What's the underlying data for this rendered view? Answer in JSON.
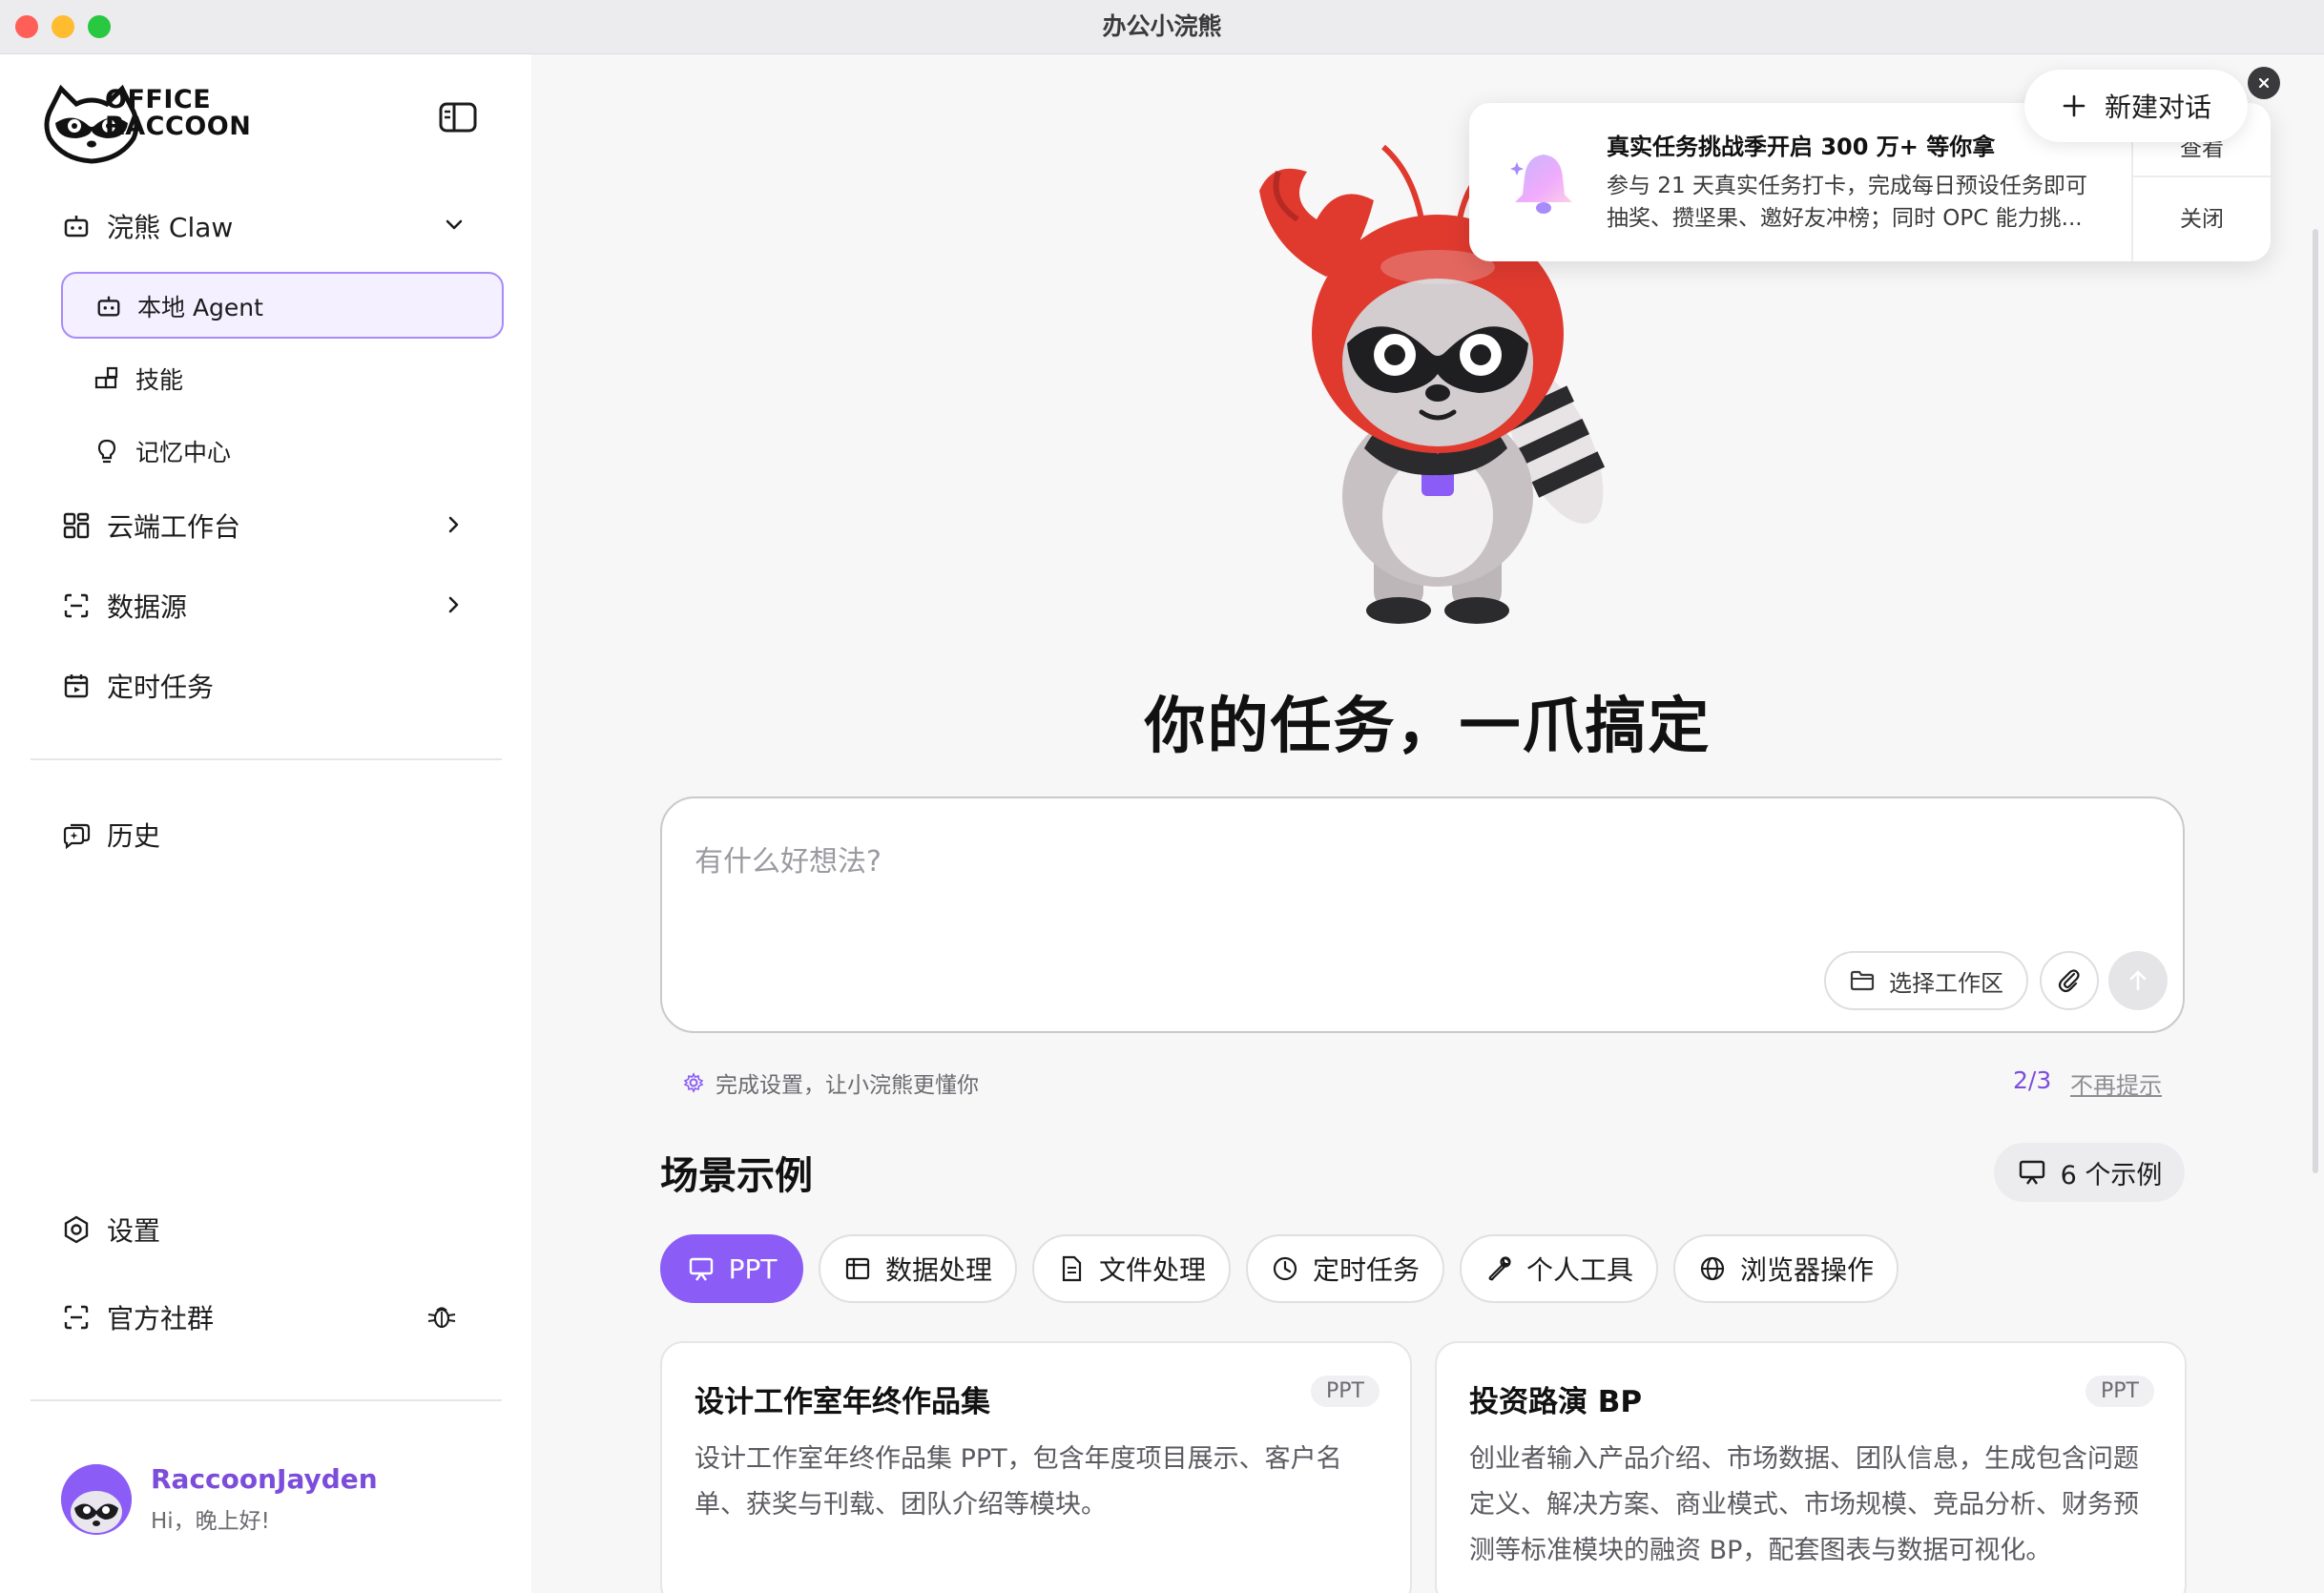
{
  "window": {
    "title": "办公小浣熊"
  },
  "sidebar": {
    "logo_text_1": "OFFICE",
    "logo_text_2": "RACCOON",
    "claw": {
      "label": "浣熊 Claw"
    },
    "claw_items": [
      {
        "label": "本地 Agent",
        "icon": "robot-icon",
        "selected": true
      },
      {
        "label": "技能",
        "icon": "skills-icon"
      },
      {
        "label": "记忆中心",
        "icon": "bulb-icon"
      }
    ],
    "cloud": {
      "label": "云端工作台"
    },
    "datasource": {
      "label": "数据源"
    },
    "scheduled": {
      "label": "定时任务"
    },
    "history": {
      "label": "历史"
    },
    "settings": {
      "label": "设置"
    },
    "community": {
      "label": "官方社群"
    },
    "user": {
      "name": "RaccoonJayden",
      "greeting": "Hi，晚上好!"
    }
  },
  "header": {
    "new_chat_label": "新建对话"
  },
  "notification": {
    "title": "真实任务挑战季开启 300 万+ 等你拿",
    "body": "参与 21 天真实任务打卡，完成每日预设任务即可抽奖、攒坚果、邀好友冲榜；同时 OPC 能力挑...",
    "view_label": "查看",
    "close_label": "关闭"
  },
  "main": {
    "headline": "你的任务，一爪搞定",
    "prompt": {
      "placeholder": "有什么好想法?",
      "value": "",
      "workspace_label": "选择工作区"
    },
    "setup": {
      "hint": "完成设置，让小浣熊更懂你",
      "progress": "2/3",
      "dismiss": "不再提示"
    },
    "scenes_title": "场景示例",
    "examples_label": "6 个示例",
    "categories": [
      {
        "label": "PPT",
        "icon": "presentation-icon",
        "active": true
      },
      {
        "label": "数据处理",
        "icon": "table-icon"
      },
      {
        "label": "文件处理",
        "icon": "document-icon"
      },
      {
        "label": "定时任务",
        "icon": "clock-icon"
      },
      {
        "label": "个人工具",
        "icon": "wrench-icon"
      },
      {
        "label": "浏览器操作",
        "icon": "globe-icon"
      }
    ],
    "cards": [
      {
        "title": "设计工作室年终作品集",
        "tag": "PPT",
        "desc": "设计工作室年终作品集 PPT，包含年度项目展示、客户名单、获奖与刊载、团队介绍等模块。"
      },
      {
        "title": "投资路演 BP",
        "tag": "PPT",
        "desc": "创业者输入产品介绍、市场数据、团队信息，生成包含问题定义、解决方案、商业模式、市场规模、竞品分析、财务预测等标准模块的融资 BP，配套图表与数据可视化。"
      }
    ]
  },
  "colors": {
    "accent": "#8b5cf6",
    "accent_dark": "#7c4ddb",
    "mascot_red": "#e03a2f"
  }
}
